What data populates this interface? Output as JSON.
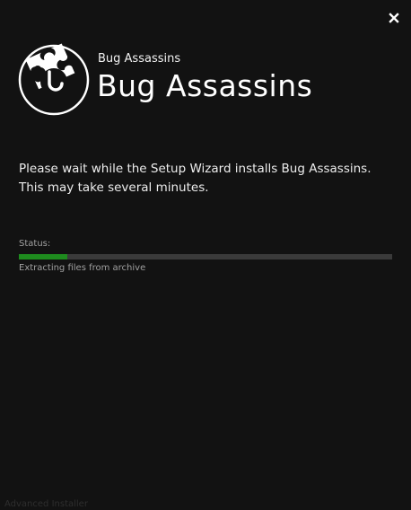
{
  "window": {
    "close_icon": "close-icon"
  },
  "header": {
    "logo_icon": "puzzle-piece-icon",
    "app_name_small": "Bug Assassins",
    "app_name_large": "Bug Assassins"
  },
  "main": {
    "message": "Please wait while the Setup Wizard installs Bug Assassins.  This may take several minutes.",
    "status_label": "Status:",
    "progress_fraction": 0.13,
    "status_text": "Extracting files from archive"
  },
  "footer": {
    "label": "Advanced Installer"
  },
  "colors": {
    "background": "#121212",
    "progress_fill": "#1e8b1e",
    "progress_track": "#3a3a3a"
  }
}
